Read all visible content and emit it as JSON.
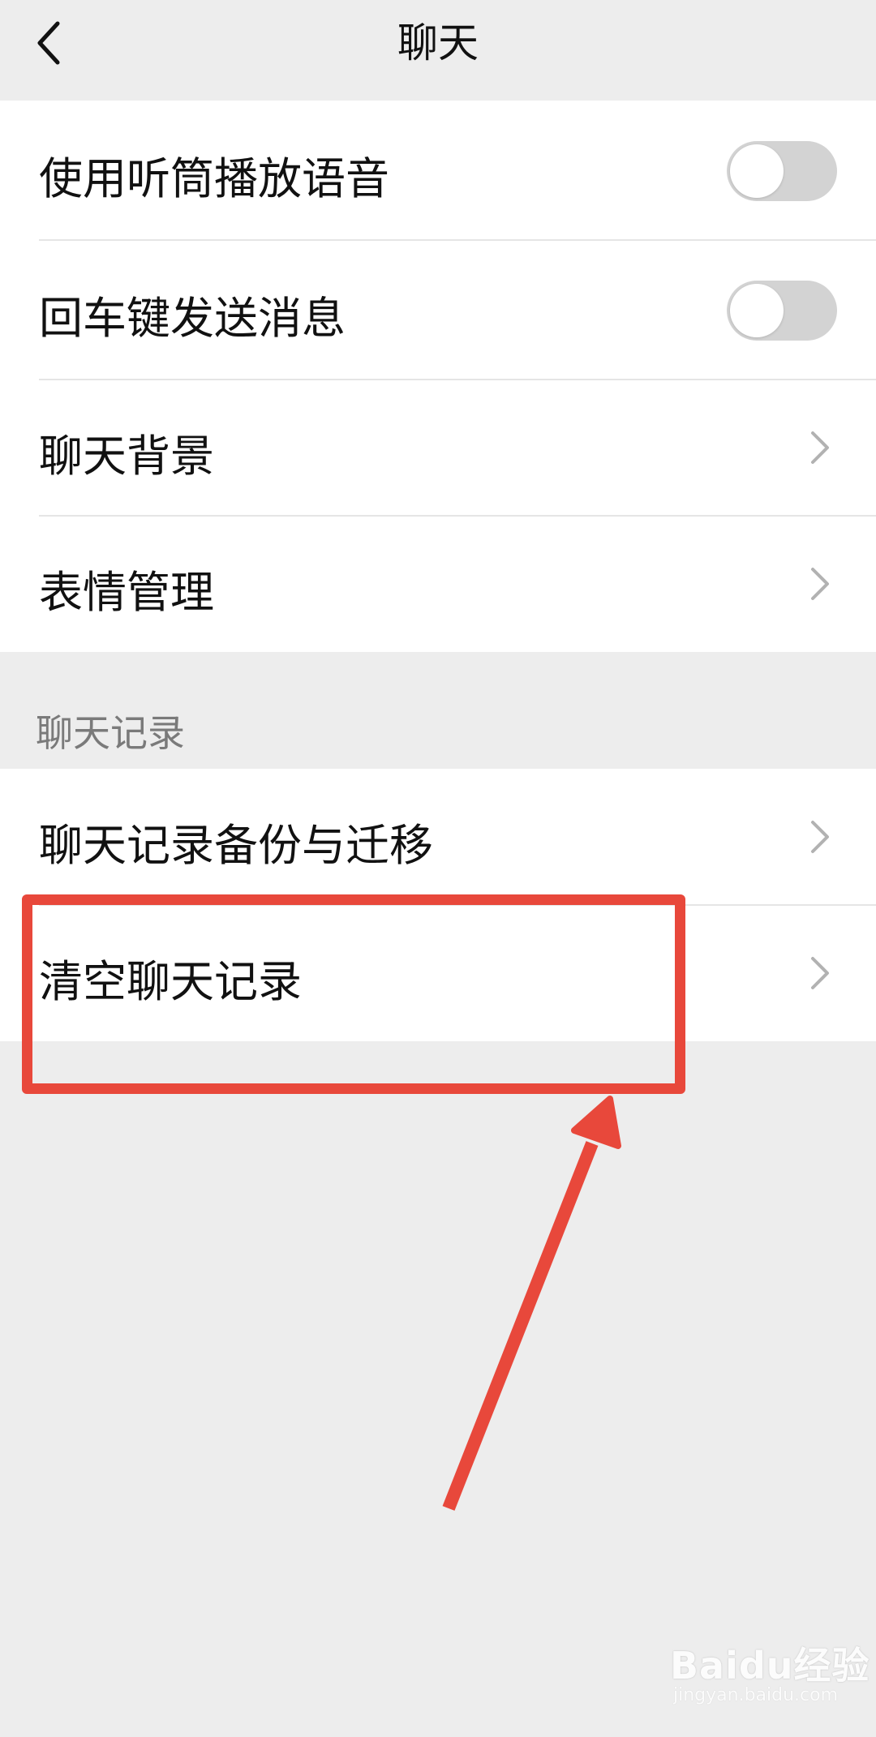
{
  "header": {
    "title": "聊天",
    "back_icon": "chevron-left-icon"
  },
  "settings": {
    "rows": [
      {
        "label": "使用听筒播放语音",
        "control": "switch",
        "on": false
      },
      {
        "label": "回车键发送消息",
        "control": "switch",
        "on": false
      },
      {
        "label": "聊天背景",
        "control": "chevron-right-icon"
      },
      {
        "label": "表情管理",
        "control": "chevron-right-icon"
      }
    ]
  },
  "chat_history": {
    "section_title": "聊天记录",
    "rows": [
      {
        "label": "聊天记录备份与迁移",
        "control": "chevron-right-icon"
      },
      {
        "label": "清空聊天记录",
        "control": "chevron-right-icon"
      }
    ]
  },
  "annotation": {
    "color": "#e8483b",
    "highlighted_item": "清空聊天记录"
  },
  "watermark": {
    "brand": "Baidu经验",
    "url": "jingyan.baidu.com"
  },
  "colors": {
    "background": "#ededed",
    "card": "#ffffff",
    "switch_off": "#d3d3d3",
    "secondary_text": "#7a7a7a"
  }
}
